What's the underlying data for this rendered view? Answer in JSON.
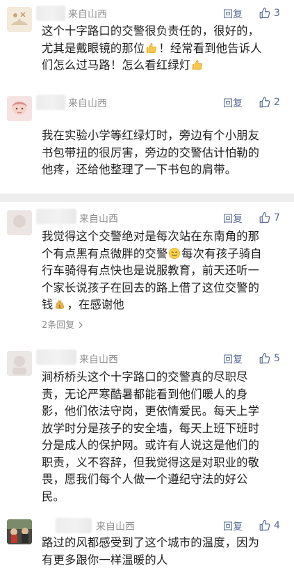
{
  "colors": {
    "link": "#576b95",
    "meta_text": "#8f8f8f",
    "body_text": "#1f1f1f",
    "separator": "#ededed"
  },
  "comments": [
    {
      "location": "来自山西",
      "reply_label": "回复",
      "like_count": "3",
      "lines": [
        "这个十字路口的交警很负责任的，很好的，",
        "尤其是戴眼镜的那位",
        "！经常看到他告诉人",
        "们怎么过马路！怎么看红绿灯"
      ]
    },
    {
      "location": "来自山西",
      "reply_label": "回复",
      "like_count": "2",
      "lines": [
        "我在实验小学等红绿灯时，旁边有个小朋友",
        "书包带扭的很厉害，旁边的交警估计怕勒的",
        "他疼，还给他整理了一下书包的肩带。"
      ]
    },
    {
      "location": "来自山西",
      "reply_label": "回复",
      "like_count": "7",
      "lines": [
        "我觉得这个交警绝对是每次站在东南角的那",
        "个有点黑有点微胖的交警",
        "每次有孩子骑自",
        "行车骑得有点快也是说服教育，前天还听一",
        "个家长说孩子在回去的路上借了这位交警的",
        "钱",
        "，在感谢他"
      ],
      "sub_replies": "2条回复"
    },
    {
      "location": "来自山西",
      "reply_label": "回复",
      "like_count": "5",
      "lines": [
        "涧桥桥头这个十字路口的交警真的尽职尽",
        "责，无论严寒酷暑都能看到他们暖人的身",
        "影，他们依法守岗，更依情爱民。每天上学",
        "放学时分是孩子的安全墙，每天上班下班时",
        "分是成人的保护网。或许有人说这是他们的",
        "职责，义不容辞，但我觉得这是对职业的敬",
        "畏，愿我们每个人做一个遵纪守法的好公",
        "民。"
      ]
    },
    {
      "location": "来自山西",
      "reply_label": "回复",
      "like_count": "4",
      "lines": [
        "路过的风都感受到了这个城市的温度，因为",
        "有更多跟你一样温暖的人"
      ]
    }
  ],
  "icons": {
    "like": "thumbs-up-outline-icon",
    "thumbs_emoji": "thumbs-up-emoji-icon",
    "smile_emoji": "smile-emoji-icon",
    "money_emoji": "money-bag-emoji-icon",
    "chevron": "chevron-right-icon"
  }
}
